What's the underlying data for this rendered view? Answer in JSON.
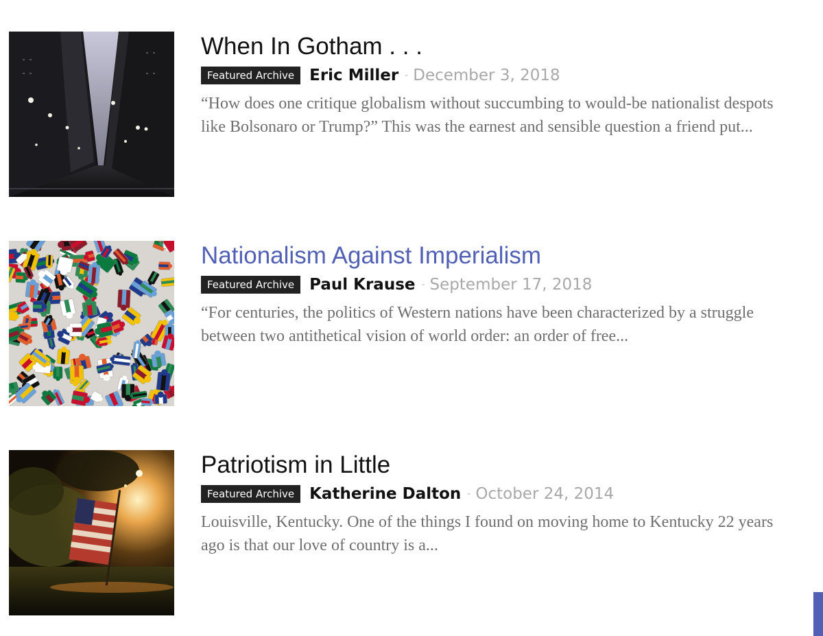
{
  "posts": [
    {
      "title": "When In Gotham . . .",
      "badge": "Featured Archive",
      "author": "Eric Miller",
      "separator": "-",
      "date": "December 3, 2018",
      "excerpt_lines": [
        "“How does one critique globalism without succumbing to would-be nationalist despots",
        "like Bolsonaro or Trump?” This was the earnest and sensible question a friend put..."
      ],
      "thumbnail": "city-street-night-image"
    },
    {
      "title": "Nationalism Against Imperialism",
      "badge": "Featured Archive",
      "author": "Paul Krause",
      "separator": "-",
      "date": "September 17, 2018",
      "excerpt_lines": [
        "“For centuries, the politics of Western nations have been characterized by a struggle",
        "between two antithetical vision of world order: an order of free..."
      ],
      "thumbnail": "flag-puzzle-pieces-image",
      "title_color": "#5160b4"
    },
    {
      "title": "Patriotism in Little",
      "badge": "Featured Archive",
      "author": "Katherine Dalton",
      "separator": "-",
      "date": "October 24, 2014",
      "excerpt_lines": [
        "Louisville, Kentucky.  One of the things I found on moving home to Kentucky 22 years",
        "ago is that our love of country is a..."
      ],
      "thumbnail": "flag-at-dusk-image"
    }
  ],
  "colors": {
    "accent": "#5160b4",
    "badge_bg": "#222222",
    "date": "#a8a8a8",
    "excerpt": "#6e6e6e"
  }
}
